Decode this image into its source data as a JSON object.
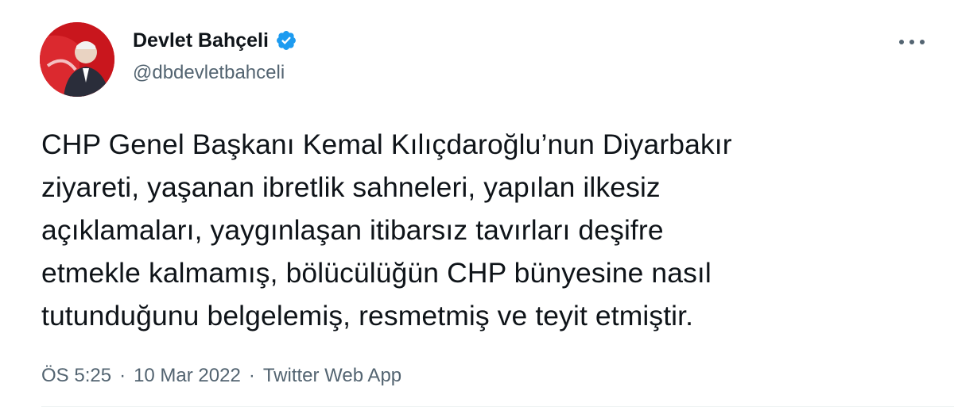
{
  "author": {
    "name": "Devlet Bahçeli",
    "handle": "@dbdevletbahceli",
    "verified": true,
    "verified_color": "#1d9bf0",
    "avatar_icon": "profile-photo"
  },
  "more_icon": "more-horizontal-icon",
  "tweet": {
    "text": "CHP Genel Başkanı Kemal Kılıçdaroğlu’nun Diyarbakır\nziyareti, yaşanan ibretlik sahneleri, yapılan ilkesiz\naçıklamaları, yaygınlaşan itibarsız tavırları deşifre\netmekle kalmamış, bölücülüğün CHP bünyesine nasıl\ntutunduğunu belgelemiş, resmetmiş ve teyit etmiştir."
  },
  "meta": {
    "time": "ÖS 5:25",
    "separator1": "·",
    "date": "10 Mar 2022",
    "separator2": "·",
    "source": "Twitter Web App"
  },
  "colors": {
    "text": "#0f1419",
    "secondary": "#536471",
    "avatar_bg": "#d11f26"
  }
}
